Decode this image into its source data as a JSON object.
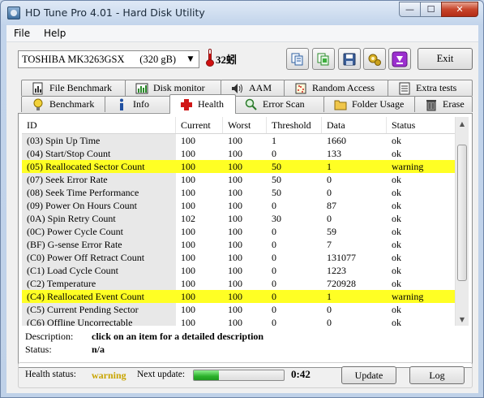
{
  "window": {
    "title": "HD Tune Pro 4.01 - Hard Disk Utility",
    "buttons": {
      "minimize": "—",
      "maximize": "☐",
      "close": "✕"
    }
  },
  "menu": [
    "File",
    "Help"
  ],
  "toolbar": {
    "drive": "TOSHIBA MK3263GSX      (320 gB)",
    "temperature": "32蚓",
    "icons": [
      "copy-info-icon",
      "copy-screen-icon",
      "save-icon",
      "options-icon",
      "minimize-to-tray-icon"
    ],
    "exit_label": "Exit"
  },
  "tabs_top": [
    {
      "label": "File Benchmark",
      "icon": "file-benchmark-icon"
    },
    {
      "label": "Disk monitor",
      "icon": "disk-monitor-icon"
    },
    {
      "label": "AAM",
      "icon": "speaker-icon"
    },
    {
      "label": "Random Access",
      "icon": "random-access-icon"
    },
    {
      "label": "Extra tests",
      "icon": "extra-tests-icon"
    }
  ],
  "tabs_bottom": [
    {
      "label": "Benchmark",
      "icon": "lightbulb-icon"
    },
    {
      "label": "Info",
      "icon": "info-icon"
    },
    {
      "label": "Health",
      "icon": "red-cross-icon",
      "active": true
    },
    {
      "label": "Error Scan",
      "icon": "magnifier-icon"
    },
    {
      "label": "Folder Usage",
      "icon": "folder-icon"
    },
    {
      "label": "Erase",
      "icon": "trash-icon"
    }
  ],
  "health_table": {
    "columns": [
      "ID",
      "Current",
      "Worst",
      "Threshold",
      "Data",
      "Status"
    ],
    "rows": [
      [
        "(03) Spin Up Time",
        "100",
        "100",
        "1",
        "1660",
        "ok"
      ],
      [
        "(04) Start/Stop Count",
        "100",
        "100",
        "0",
        "133",
        "ok"
      ],
      [
        "(05) Reallocated Sector Count",
        "100",
        "100",
        "50",
        "1",
        "warning"
      ],
      [
        "(07) Seek Error Rate",
        "100",
        "100",
        "50",
        "0",
        "ok"
      ],
      [
        "(08) Seek Time Performance",
        "100",
        "100",
        "50",
        "0",
        "ok"
      ],
      [
        "(09) Power On Hours Count",
        "100",
        "100",
        "0",
        "87",
        "ok"
      ],
      [
        "(0A) Spin Retry Count",
        "102",
        "100",
        "30",
        "0",
        "ok"
      ],
      [
        "(0C) Power Cycle Count",
        "100",
        "100",
        "0",
        "59",
        "ok"
      ],
      [
        "(BF) G-sense Error Rate",
        "100",
        "100",
        "0",
        "7",
        "ok"
      ],
      [
        "(C0) Power Off Retract Count",
        "100",
        "100",
        "0",
        "131077",
        "ok"
      ],
      [
        "(C1) Load Cycle Count",
        "100",
        "100",
        "0",
        "1223",
        "ok"
      ],
      [
        "(C2) Temperature",
        "100",
        "100",
        "0",
        "720928",
        "ok"
      ],
      [
        "(C4) Reallocated Event Count",
        "100",
        "100",
        "0",
        "1",
        "warning"
      ],
      [
        "(C5) Current Pending Sector",
        "100",
        "100",
        "0",
        "0",
        "ok"
      ],
      [
        "(C6) Offline Uncorrectable",
        "100",
        "100",
        "0",
        "0",
        "ok"
      ]
    ],
    "warning_color": "#ffff24"
  },
  "description": {
    "label": "Description:",
    "value": "click on an item for a detailed description"
  },
  "status": {
    "label": "Status:",
    "value": "n/a"
  },
  "footer": {
    "health_status_label": "Health status:",
    "health_status_value": "warning",
    "health_status_color": "#c8a400",
    "next_update_label": "Next update:",
    "progress_fraction": 0.28,
    "countdown": "0:42",
    "update_label": "Update",
    "log_label": "Log"
  }
}
